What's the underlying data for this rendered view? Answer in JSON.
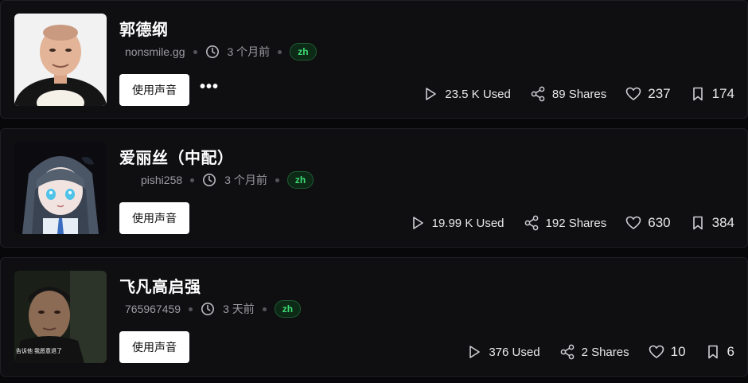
{
  "voices": [
    {
      "name": "郭德纲",
      "author": "nonsmile.gg",
      "time": "3 个月前",
      "lang": "zh",
      "use_label": "使用声音",
      "more_label": "•••",
      "used": "23.5 K Used",
      "shares": "89 Shares",
      "likes": "237",
      "saves": "174"
    },
    {
      "name": "爱丽丝（中配）",
      "author": "pishi258",
      "time": "3 个月前",
      "lang": "zh",
      "use_label": "使用声音",
      "used": "19.99 K Used",
      "shares": "192 Shares",
      "likes": "630",
      "saves": "384"
    },
    {
      "name": "飞凡高启强",
      "author": "765967459",
      "time": "3 天前",
      "lang": "zh",
      "use_label": "使用声音",
      "avatar_caption": "告诉他 我愿意退了",
      "used": "376 Used",
      "shares": "2 Shares",
      "likes": "10",
      "saves": "6"
    }
  ],
  "icons": {
    "used": "play-icon",
    "shares": "share-icon",
    "likes": "heart-icon",
    "saves": "bookmark-icon",
    "time": "clock-icon"
  },
  "colors": {
    "background": "#08080a",
    "card": "#0f0f12",
    "badge_text": "#3ddc74",
    "badge_bg": "#0d2a17"
  }
}
